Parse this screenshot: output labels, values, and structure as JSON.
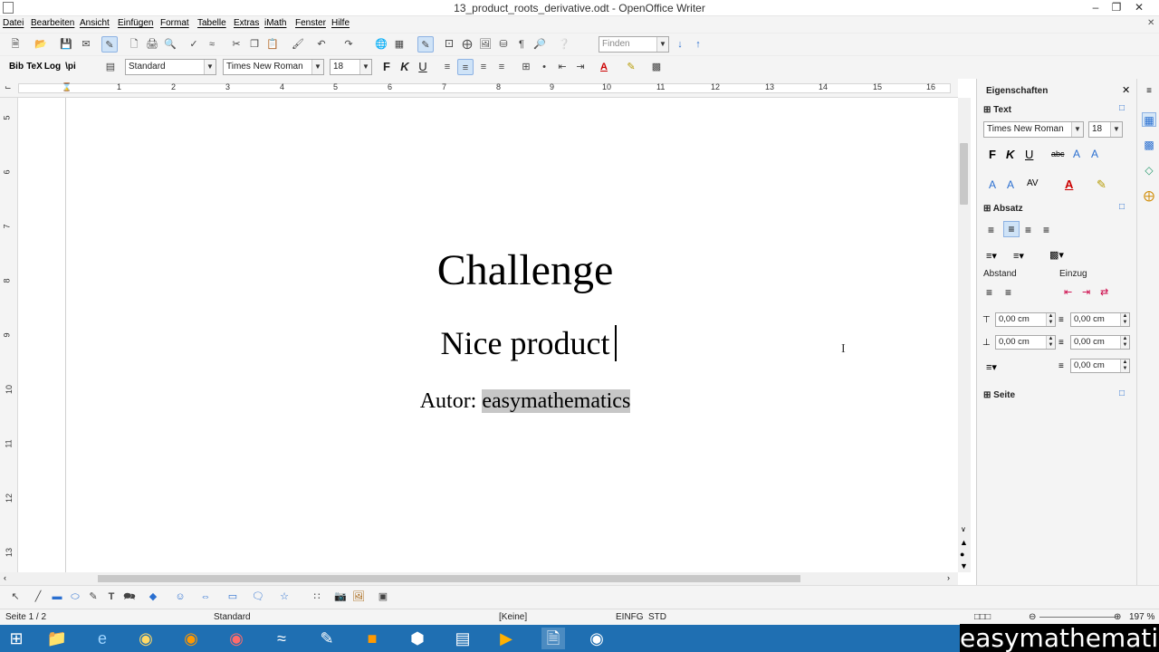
{
  "window": {
    "title": "13_product_roots_derivative.odt - OpenOffice Writer"
  },
  "menu": [
    "Datei",
    "Bearbeiten",
    "Ansicht",
    "Einfügen",
    "Format",
    "Tabelle",
    "Extras",
    "iMath",
    "Fenster",
    "Hilfe"
  ],
  "toolbar": {
    "find_placeholder": "Finden"
  },
  "formatbar": {
    "bib": "Bib",
    "tex": "TeX",
    "log": "Log",
    "pi": "\\pi",
    "style": "Standard",
    "font": "Times New Roman",
    "size": "18",
    "bold": "F",
    "italic": "K",
    "underline": "U"
  },
  "ruler": {
    "h": [
      "1",
      "2",
      "3",
      "4",
      "5",
      "6",
      "7",
      "8",
      "9",
      "10",
      "11",
      "12",
      "13",
      "14",
      "15",
      "16"
    ],
    "v": [
      "5",
      "6",
      "7",
      "8",
      "9",
      "10",
      "11",
      "12",
      "13"
    ]
  },
  "document": {
    "title": "Challenge",
    "subtitle": "Nice product",
    "author_label": "Autor: ",
    "author_name": "easymathematics"
  },
  "sidebar": {
    "title": "Eigenschaften",
    "text_section": "Text",
    "font": "Times New Roman",
    "size": "18",
    "bold": "F",
    "italic": "K",
    "underline": "U",
    "para_section": "Absatz",
    "spacing": "Abstand",
    "indent": "Einzug",
    "above": "0,00 cm",
    "below": "0,00 cm",
    "before": "0,00 cm",
    "after": "0,00 cm",
    "first": "0,00 cm",
    "page_section": "Seite"
  },
  "status": {
    "page": "Seite 1 / 2",
    "style": "Standard",
    "lang": "[Keine]",
    "mode": "EINFG",
    "sel": "STD",
    "zoom": "197 %"
  },
  "watermark": "easymathematics"
}
